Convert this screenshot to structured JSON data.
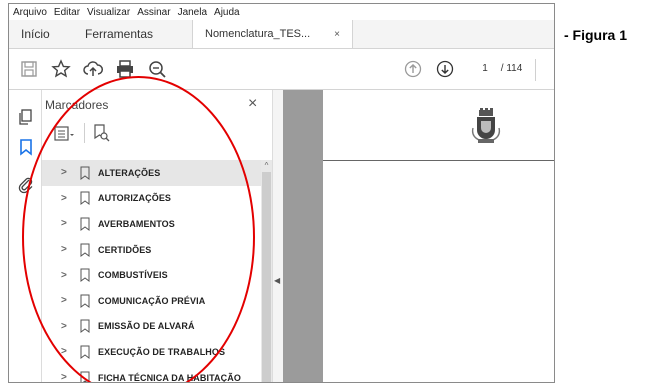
{
  "menubar": [
    "Arquivo",
    "Editar",
    "Visualizar",
    "Assinar",
    "Janela",
    "Ajuda"
  ],
  "tabs": {
    "home": "Início",
    "tools": "Ferramentas",
    "document": "Nomenclatura_TES...",
    "close": "×"
  },
  "pagination": {
    "current": "1",
    "total": "/ 114"
  },
  "panel": {
    "title": "Marcadores",
    "close": "×",
    "bookmarks": [
      "ALTERAÇÕES",
      "AUTORIZAÇÕES",
      "AVERBAMENTOS",
      "CERTIDÕES",
      "COMBUSTÍVEIS",
      "COMUNICAÇÃO PRÉVIA",
      "EMISSÃO DE ALVARÁ",
      "EXECUÇÃO DE TRABALHOS",
      "FICHA TÉCNICA DA HABITAÇÃO"
    ]
  },
  "caption": "- Figura 1",
  "colors": {
    "annotation": "#e30000",
    "doc_background": "#9b9b9b",
    "selected_row": "#e6e6e6"
  },
  "icons": [
    "save-icon",
    "star-icon",
    "cloud-upload-icon",
    "print-icon",
    "zoom-icon",
    "page-up-icon",
    "page-down-icon",
    "pages-icon",
    "bookmark-icon",
    "attachment-icon",
    "options-icon",
    "bookmark-search-icon",
    "chevron-right-icon",
    "bookmark-flag-icon",
    "crest-icon"
  ]
}
